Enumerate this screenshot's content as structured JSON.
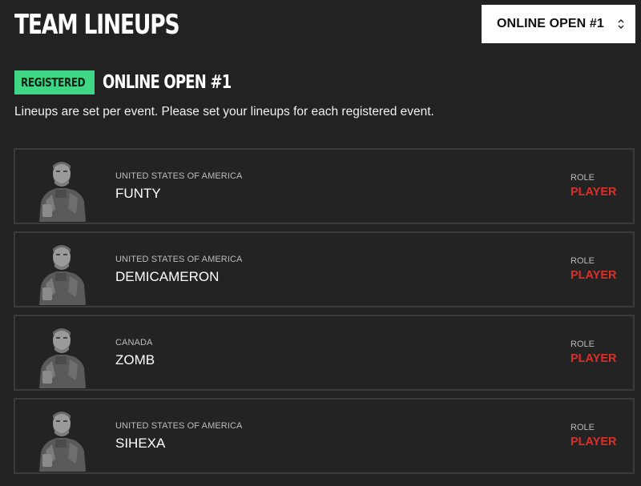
{
  "header": {
    "title": "TEAM LINEUPS"
  },
  "event_selector": {
    "selected": "ONLINE OPEN #1",
    "icon": "chevron-up-down-icon"
  },
  "status": {
    "badge": "REGISTERED",
    "event_name": "ONLINE OPEN #1",
    "badge_color": "#3fd685"
  },
  "info_text": "Lineups are set per event. Please set your lineups for each registered event.",
  "colors": {
    "background": "#222222",
    "card_border": "#3a3a3a",
    "role_value": "#d9302a"
  },
  "players": [
    {
      "country": "UNITED STATES OF AMERICA",
      "name": "FUNTY",
      "role_label": "ROLE",
      "role": "PLAYER"
    },
    {
      "country": "UNITED STATES OF AMERICA",
      "name": "DEMICAMERON",
      "role_label": "ROLE",
      "role": "PLAYER"
    },
    {
      "country": "CANADA",
      "name": "ZOMB",
      "role_label": "ROLE",
      "role": "PLAYER"
    },
    {
      "country": "UNITED STATES OF AMERICA",
      "name": "SIHEXA",
      "role_label": "ROLE",
      "role": "PLAYER"
    }
  ]
}
